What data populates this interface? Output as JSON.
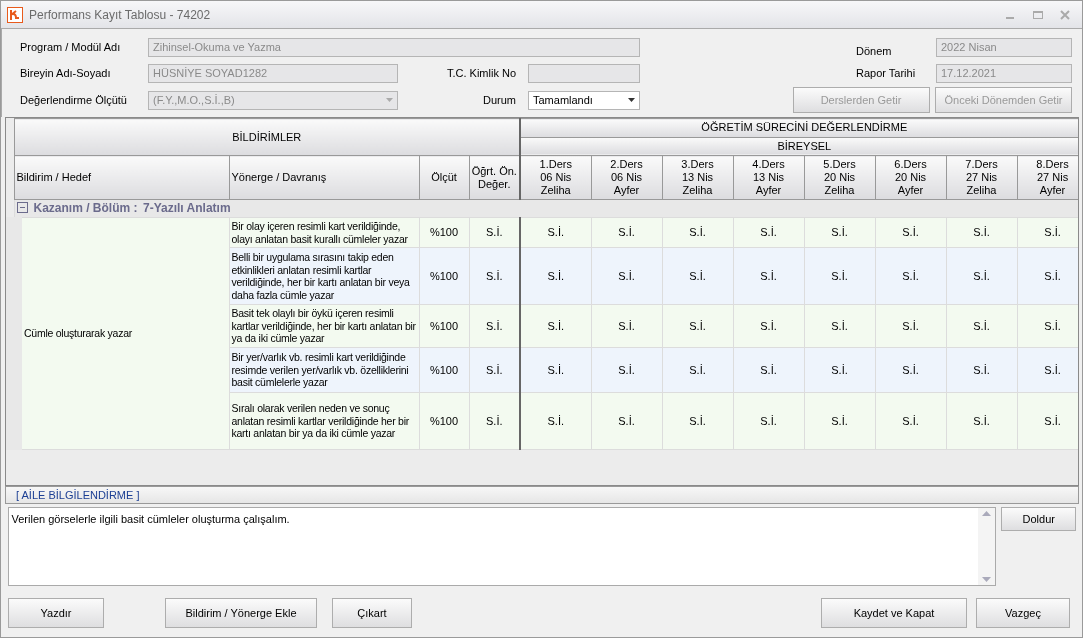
{
  "window": {
    "title": "Performans Kayıt Tablosu - 74202"
  },
  "form": {
    "fields": [
      {
        "label": "Program / Modül Adı",
        "value": "Zihinsel-Okuma ve Yazma",
        "disabled": true,
        "kind": "text"
      },
      {
        "label": "Bireyin Adı-Soyadı",
        "value": "HÜSNİYE SOYAD1282",
        "disabled": true,
        "kind": "text"
      },
      {
        "label": "T.C. Kimlik No",
        "disabled": true,
        "kind": "text"
      },
      {
        "label": "Değerlendirme Ölçütü",
        "value": "(F.Y.,M.O.,S.İ.,B)",
        "disabled": true,
        "kind": "select"
      },
      {
        "label": "Durum",
        "value": "Tamamlandı",
        "disabled": false,
        "kind": "select"
      },
      {
        "label": "Dönem",
        "value": "2022 Nisan",
        "disabled": true,
        "kind": "text"
      },
      {
        "label": "Rapor Tarihi",
        "value": "17.12.2021",
        "disabled": true,
        "kind": "text"
      }
    ],
    "buttons": [
      {
        "label": "Derslerden Getir",
        "disabled": true
      },
      {
        "label": "Önceki Dönemden Getir",
        "disabled": true
      }
    ]
  },
  "table": {
    "group_left": "BİLDİRİMLER",
    "group_right": "ÖĞRETİM SÜRECİNİ DEĞERLENDİRME",
    "subgroup_right": "BİREYSEL",
    "columns": [
      "Bildirim / Hedef",
      "Yönerge / Davranış",
      "Ölçüt",
      "Öğrt. Ön. Değer."
    ],
    "lessons": [
      {
        "lesson": "1.Ders",
        "date": "06 Nis",
        "teacher": "Zeliha"
      },
      {
        "lesson": "2.Ders",
        "date": "06 Nis",
        "teacher": "Ayfer"
      },
      {
        "lesson": "3.Ders",
        "date": "13 Nis",
        "teacher": "Zeliha"
      },
      {
        "lesson": "4.Ders",
        "date": "13 Nis",
        "teacher": "Ayfer"
      },
      {
        "lesson": "5.Ders",
        "date": "20 Nis",
        "teacher": "Zeliha"
      },
      {
        "lesson": "6.Ders",
        "date": "20 Nis",
        "teacher": "Ayfer"
      },
      {
        "lesson": "7.Ders",
        "date": "27 Nis",
        "teacher": "Zeliha"
      },
      {
        "lesson": "8.Ders",
        "date": "27 Nis",
        "teacher": "Ayfer"
      }
    ],
    "group": {
      "label": "Kazanım / Bölüm :",
      "value": "7-Yazılı Anlatım",
      "expanded": true
    },
    "hedef": "Cümle oluşturarak yazar",
    "rows": [
      {
        "yonerge": "Bir olay içeren resimli kart verildiğinde, olayı anlatan basit kurallı cümleler yazar",
        "olcut": "%100",
        "on_deger": "S.İ.",
        "scores": [
          "S.İ.",
          "S.İ.",
          "S.İ.",
          "S.İ.",
          "S.İ.",
          "S.İ.",
          "S.İ.",
          "S.İ."
        ]
      },
      {
        "yonerge": "Belli bir uygulama sırasını takip eden etkinlikleri anlatan resimli kartlar verildiğinde, her bir kartı anlatan bir veya daha fazla cümle yazar",
        "olcut": "%100",
        "on_deger": "S.İ.",
        "scores": [
          "S.İ.",
          "S.İ.",
          "S.İ.",
          "S.İ.",
          "S.İ.",
          "S.İ.",
          "S.İ.",
          "S.İ."
        ]
      },
      {
        "yonerge": "Basit tek olaylı bir öykü içeren resimli kartlar verildiğinde, her bir kartı anlatan bir ya da iki cümle yazar",
        "olcut": "%100",
        "on_deger": "S.İ.",
        "scores": [
          "S.İ.",
          "S.İ.",
          "S.İ.",
          "S.İ.",
          "S.İ.",
          "S.İ.",
          "S.İ.",
          "S.İ."
        ]
      },
      {
        "yonerge": "Bir yer/varlık vb. resimli kart verildiğinde resimde verilen yer/varlık vb. özelliklerini basit cümlelerle yazar",
        "olcut": "%100",
        "on_deger": "S.İ.",
        "scores": [
          "S.İ.",
          "S.İ.",
          "S.İ.",
          "S.İ.",
          "S.İ.",
          "S.İ.",
          "S.İ.",
          "S.İ."
        ]
      },
      {
        "yonerge": "Sıralı olarak verilen neden ve sonuç anlatan resimli kartlar verildiğinde her bir kartı anlatan bir ya da iki cümle yazar",
        "olcut": "%100",
        "on_deger": "S.İ.",
        "scores": [
          "S.İ.",
          "S.İ.",
          "S.İ.",
          "S.İ.",
          "S.İ.",
          "S.İ.",
          "S.İ.",
          "S.İ."
        ]
      }
    ]
  },
  "family": {
    "title": "[ AİLE BİLGİLENDİRME ]",
    "text": "Verilen görselerle ilgili basit cümleler oluşturma çalışalım.",
    "button": "Doldur"
  },
  "footer": {
    "left": [
      "Yazdır",
      "Bildirim / Yönerge Ekle",
      "Çıkart"
    ],
    "right": [
      "Kaydet ve Kapat",
      "Vazgeç"
    ]
  }
}
